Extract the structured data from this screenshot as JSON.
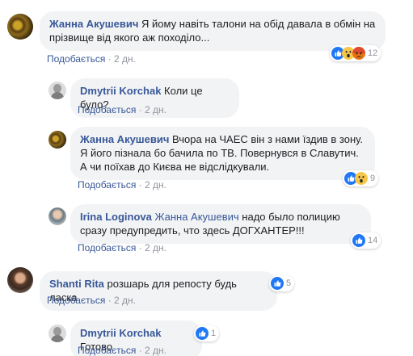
{
  "comments": [
    {
      "author": "Жанна Акушевич",
      "text": "Я йому навіть талони на обід давала в обмін на прізвище від якого аж походіло...",
      "like_label": "Подобається",
      "time": "2 дн.",
      "reactions": [
        "like",
        "wow",
        "angry"
      ],
      "reaction_count": "12"
    },
    {
      "author": "Dmytrii Korchak",
      "text": "Коли це було?",
      "like_label": "Подобається",
      "time": "2 дн."
    },
    {
      "author": "Жанна Акушевич",
      "text": "Вчора на ЧАЕС він з нами їздив в зону. Я його пізнала бо бачила по ТВ. Повернувся в Славутич. А чи поїхав до Києва не відслідкували.",
      "like_label": "Подобається",
      "time": "2 дн.",
      "reactions": [
        "like",
        "wow"
      ],
      "reaction_count": "9"
    },
    {
      "author": "Irina Loginova",
      "mention": "Жанна Акушевич",
      "text": "надо было полицию сразу предупредить, что здесь ДОГХАНТЕР!!!",
      "like_label": "Подобається",
      "time": "2 дн.",
      "reactions": [
        "like"
      ],
      "reaction_count": "14"
    },
    {
      "author": "Shanti Rita",
      "text": "розшарь для репосту будь ласка",
      "like_label": "Подобається",
      "time": "2 дн.",
      "reactions": [
        "like"
      ],
      "reaction_count": "5"
    },
    {
      "author": "Dmytrii Korchak",
      "text": "Готово",
      "like_label": "Подобається",
      "time": "2 дн.",
      "reactions": [
        "like"
      ],
      "reaction_count": "1"
    }
  ],
  "separator": "·",
  "colors": {
    "link": "#385898",
    "bubble": "#f2f3f5",
    "meta": "#90949c",
    "like_blue": "#2078f4",
    "wow_yellow": "#f7c74a",
    "angry_red": "#e9710f"
  }
}
